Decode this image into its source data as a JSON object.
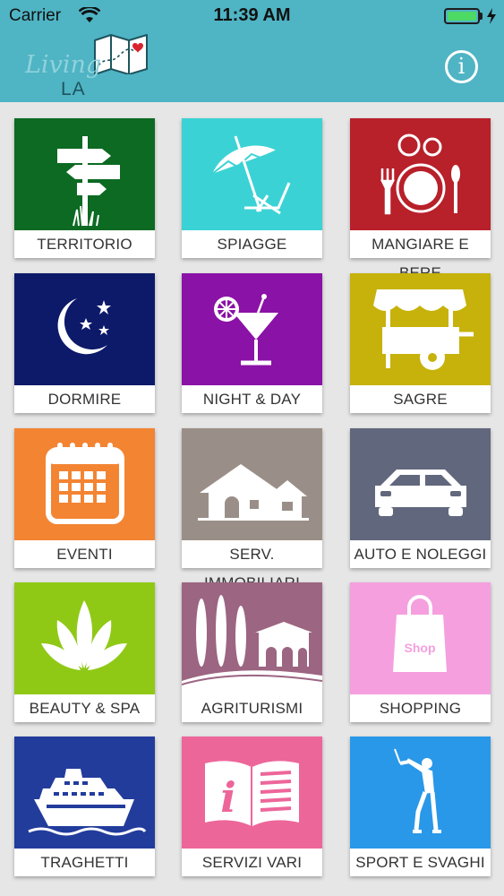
{
  "status_bar": {
    "carrier": "Carrier",
    "time": "11:39 AM"
  },
  "header": {
    "logo_script": "Living",
    "logo_sub": "LA SPEZIA",
    "info_label": "i"
  },
  "tiles": [
    {
      "label": "TERRITORIO",
      "color": "#0c6a22",
      "icon": "signpost-icon"
    },
    {
      "label": "SPIAGGE",
      "color": "#3bd2d5",
      "icon": "beach-umbrella-icon"
    },
    {
      "label": "MANGIARE E BERE",
      "color": "#b8202a",
      "icon": "plate-cutlery-icon"
    },
    {
      "label": "DORMIRE",
      "color": "#0d1a6a",
      "icon": "moon-stars-icon"
    },
    {
      "label": "NIGHT & DAY",
      "color": "#8a12a6",
      "icon": "cocktail-icon"
    },
    {
      "label": "SAGRE",
      "color": "#c6b20a",
      "icon": "market-cart-icon"
    },
    {
      "label": "EVENTI",
      "color": "#f38432",
      "icon": "calendar-icon"
    },
    {
      "label": "SERV. IMMOBILIARI",
      "color": "#9a8f88",
      "icon": "house-icon"
    },
    {
      "label": "AUTO E NOLEGGI",
      "color": "#61677c",
      "icon": "car-icon"
    },
    {
      "label": "BEAUTY & SPA",
      "color": "#8fc916",
      "icon": "leaves-icon"
    },
    {
      "label": "AGRITURISMI",
      "color": "#9c6582",
      "icon": "farmhouse-icon"
    },
    {
      "label": "SHOPPING",
      "color": "#f59fdf",
      "icon": "shopping-bag-icon",
      "bag_text": "Shop"
    },
    {
      "label": "TRAGHETTI",
      "color": "#223c9c",
      "icon": "ferry-icon"
    },
    {
      "label": "SERVIZI VARI",
      "color": "#ed669a",
      "icon": "info-book-icon"
    },
    {
      "label": "SPORT E SVAGHI",
      "color": "#2998e8",
      "icon": "golfer-icon"
    }
  ]
}
